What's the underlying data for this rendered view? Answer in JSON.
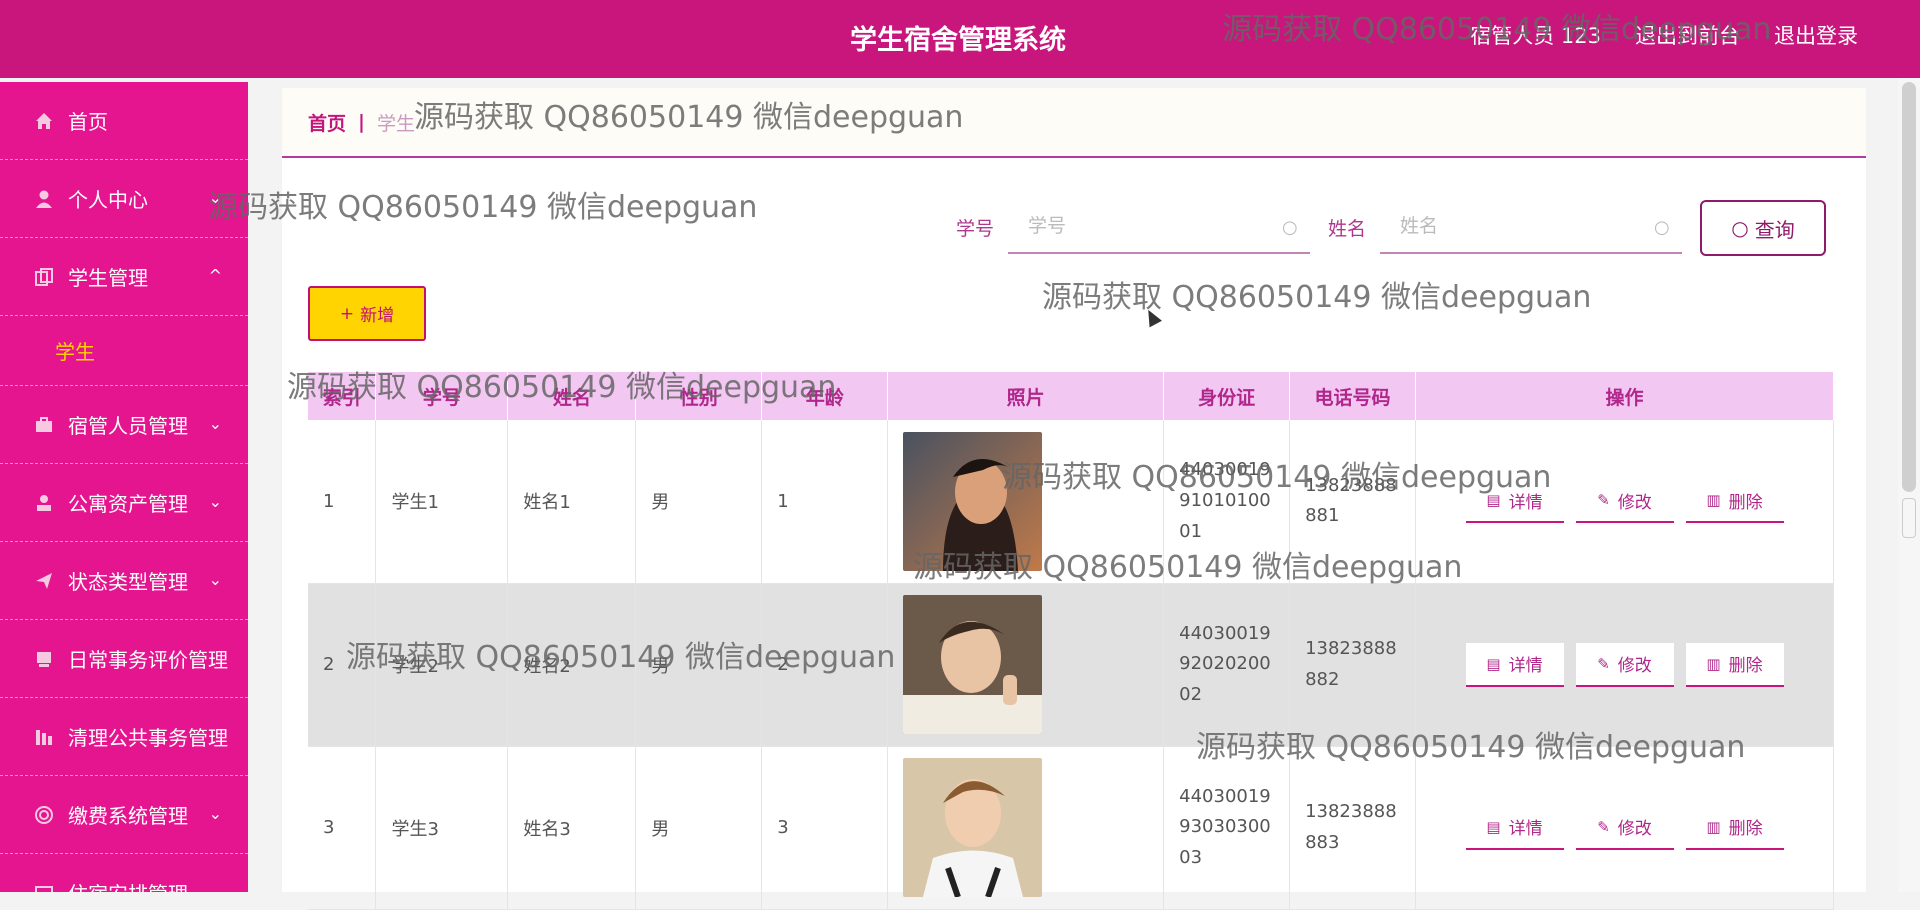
{
  "header": {
    "title": "学生宿舍管理系统",
    "user": "宿管人员 123",
    "back_front": "退出到前台",
    "logout": "退出登录"
  },
  "sidebar": {
    "items": [
      {
        "label": "首页",
        "icon": "home-icon"
      },
      {
        "label": "个人中心",
        "icon": "user-icon"
      },
      {
        "label": "学生管理",
        "icon": "copy-icon"
      },
      {
        "label": "学生",
        "icon": ""
      },
      {
        "label": "宿管人员管理",
        "icon": "briefcase-icon"
      },
      {
        "label": "公寓资产管理",
        "icon": "person-icon"
      },
      {
        "label": "状态类型管理",
        "icon": "send-icon"
      },
      {
        "label": "日常事务评价管理",
        "icon": "tag-icon"
      },
      {
        "label": "清理公共事务管理",
        "icon": "chart-icon"
      },
      {
        "label": "缴费系统管理",
        "icon": "circle-icon"
      },
      {
        "label": "住宿安排管理",
        "icon": "box-icon"
      }
    ]
  },
  "breadcrumb": {
    "home": "首页",
    "separator": "|",
    "current": "学生"
  },
  "search": {
    "student_no_label": "学号",
    "student_no_placeholder": "学号",
    "name_label": "姓名",
    "name_placeholder": "姓名",
    "query_label": "查询"
  },
  "toolbar": {
    "add_label": "新增"
  },
  "table": {
    "headers": [
      "索引",
      "学号",
      "姓名",
      "性别",
      "年龄",
      "照片",
      "身份证",
      "电话号码",
      "操作"
    ],
    "rows": [
      {
        "index": "1",
        "student_no": "学生1",
        "name": "姓名1",
        "gender": "男",
        "age": "1",
        "id_card": "440300199101010001",
        "phone": "13823888881"
      },
      {
        "index": "2",
        "student_no": "学生2",
        "name": "姓名2",
        "gender": "男",
        "age": "2",
        "id_card": "440300199202020002",
        "phone": "13823888882"
      },
      {
        "index": "3",
        "student_no": "学生3",
        "name": "姓名3",
        "gender": "男",
        "age": "3",
        "id_card": "440300199303030003",
        "phone": "13823888883"
      }
    ],
    "actions": {
      "detail": "详情",
      "edit": "修改",
      "delete": "删除"
    }
  },
  "watermark": "源码获取 QQ86050149 微信deepguan",
  "colors": {
    "header_bg": "#c8167d",
    "sidebar_bg": "#e5158f",
    "accent_yellow": "#ffd400",
    "table_header_bg": "#f2c8f2"
  }
}
